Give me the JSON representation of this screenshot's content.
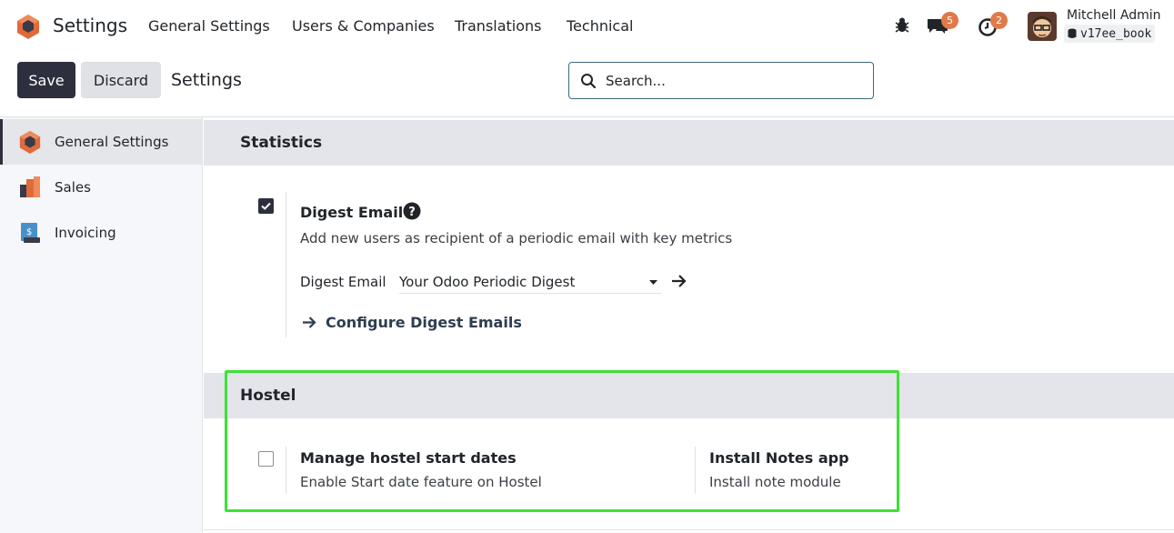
{
  "navbar": {
    "app_name": "Settings",
    "menu": [
      "General Settings",
      "Users & Companies",
      "Translations",
      "Technical"
    ],
    "messages_count": "5",
    "activities_count": "2",
    "user_name": "Mitchell Admin",
    "database": "v17ee_book"
  },
  "control_panel": {
    "save_label": "Save",
    "discard_label": "Discard",
    "breadcrumb": "Settings",
    "search_placeholder": "Search..."
  },
  "sidebar": {
    "items": [
      {
        "label": "General Settings",
        "icon": "settings-app-icon",
        "active": true
      },
      {
        "label": "Sales",
        "icon": "sales-app-icon",
        "active": false
      },
      {
        "label": "Invoicing",
        "icon": "invoicing-app-icon",
        "active": false
      }
    ]
  },
  "statistics": {
    "heading": "Statistics",
    "digest": {
      "checked": true,
      "title": "Digest Email",
      "description": "Add new users as recipient of a periodic email with key metrics",
      "field_label": "Digest Email",
      "field_value": "Your Odoo Periodic Digest",
      "configure_link": "Configure Digest Emails"
    }
  },
  "hostel": {
    "heading": "Hostel",
    "start_dates": {
      "checked": false,
      "title": "Manage hostel start dates",
      "description": "Enable Start date feature on Hostel"
    },
    "notes_app": {
      "title": "Install Notes app",
      "description": "Install note module"
    }
  },
  "colors": {
    "primary": "#2e2f3e",
    "badge": "#e07a4a",
    "section_bg": "#e3e5ea",
    "highlight": "#3de234"
  }
}
